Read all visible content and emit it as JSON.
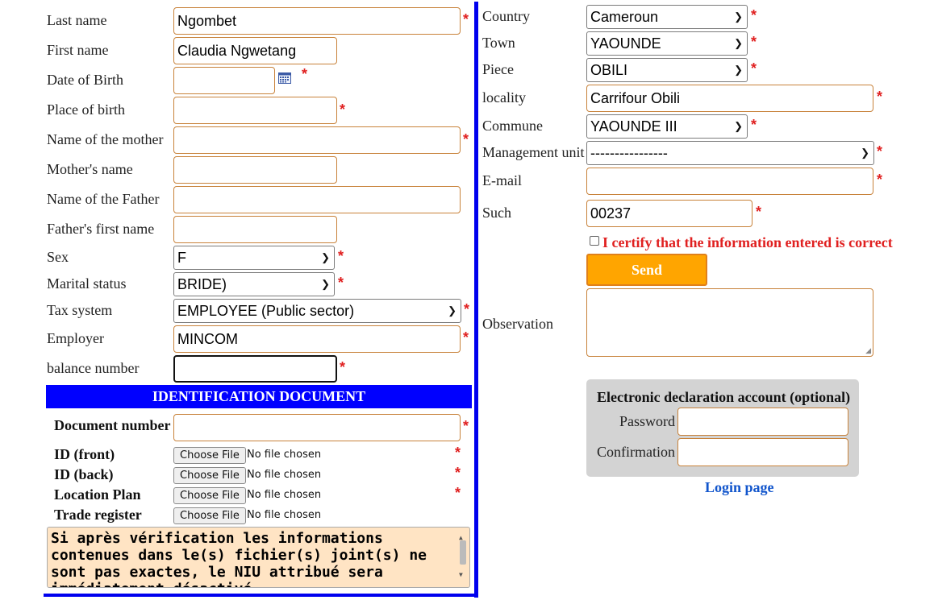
{
  "left": {
    "last_name": {
      "label": "Last name",
      "value": "Ngombet"
    },
    "first_name": {
      "label": "First name",
      "value": "Claudia Ngwetang"
    },
    "dob": {
      "label": "Date of Birth",
      "value": ""
    },
    "place_of_birth": {
      "label": "Place of birth",
      "value": ""
    },
    "mother_name": {
      "label": "Name of the mother",
      "value": ""
    },
    "mother_first": {
      "label": "Mother's name",
      "value": ""
    },
    "father_name": {
      "label": "Name of the Father",
      "value": ""
    },
    "father_first": {
      "label": "Father's first name",
      "value": ""
    },
    "sex": {
      "label": "Sex",
      "value": "F"
    },
    "marital": {
      "label": "Marital status",
      "value": "BRIDE)"
    },
    "tax": {
      "label": "Tax system",
      "value": "EMPLOYEE (Public sector)"
    },
    "employer": {
      "label": "Employer",
      "value": "MINCOM"
    },
    "balance": {
      "label": "balance number",
      "value": ""
    },
    "required_mark": "*"
  },
  "identification": {
    "header": "IDENTIFICATION DOCUMENT",
    "doc_number": {
      "label": "Document number",
      "value": ""
    },
    "choose_file": "Choose File",
    "no_file": "No file chosen",
    "files": [
      {
        "label": "ID (front)"
      },
      {
        "label": "ID (back)"
      },
      {
        "label": "Location Plan"
      },
      {
        "label": "Trade register"
      }
    ],
    "notice": "Si après vérification les informations contenues dans le(s) fichier(s) joint(s) ne sont pas exactes, le NIU attribué sera immédiatement désactivé"
  },
  "right": {
    "country": {
      "label": "Country",
      "value": "Cameroun"
    },
    "town": {
      "label": "Town",
      "value": "YAOUNDE"
    },
    "piece": {
      "label": "Piece",
      "value": "OBILI"
    },
    "locality": {
      "label": "locality",
      "value": "Carrifour Obili"
    },
    "commune": {
      "label": "Commune",
      "value": "YAOUNDE III"
    },
    "management_unit": {
      "label": "Management unit",
      "value": "----------------"
    },
    "email": {
      "label": "E-mail",
      "value": ""
    },
    "such": {
      "label": "Such",
      "value": "00237"
    },
    "certify": "I certify that the information entered is correct",
    "send": "Send",
    "observation": {
      "label": "Observation",
      "value": ""
    }
  },
  "account": {
    "title": "Electronic declaration account (optional)",
    "password": {
      "label": "Password",
      "value": ""
    },
    "confirmation": {
      "label": "Confirmation",
      "value": ""
    },
    "login_link": "Login page"
  },
  "colors": {
    "accent_blue": "#0000ff",
    "required_red": "#e02020",
    "send_orange": "#ffa500",
    "field_border": "#c8823a",
    "notice_bg": "#ffe4c4",
    "link_blue": "#1155cc"
  }
}
